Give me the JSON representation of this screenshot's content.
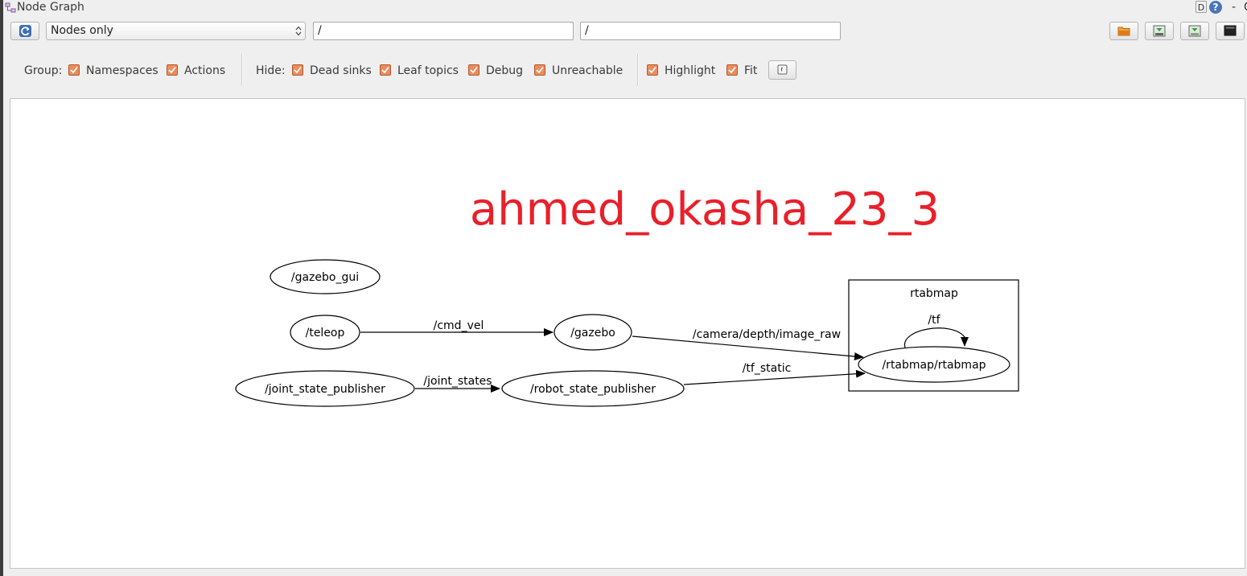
{
  "window": {
    "title": "Node Graph",
    "title_buttons": {
      "d": "D",
      "help": "?",
      "minimize": "-",
      "close": "C"
    }
  },
  "toolbar": {
    "refresh_icon": "refresh-icon",
    "graph_mode": {
      "selected": "Nodes only"
    },
    "node_filter": {
      "value": "/"
    },
    "topic_filter": {
      "value": "/"
    },
    "right_icons": [
      "load-dot-icon",
      "save-dot-icon",
      "save-image-icon",
      "save-svg-icon"
    ]
  },
  "options": {
    "group_label": "Group:",
    "group": [
      {
        "label": "Namespaces",
        "checked": true
      },
      {
        "label": "Actions",
        "checked": true
      }
    ],
    "hide_label": "Hide:",
    "hide": [
      {
        "label": "Dead sinks",
        "checked": true
      },
      {
        "label": "Leaf topics",
        "checked": true
      },
      {
        "label": "Debug",
        "checked": true
      },
      {
        "label": "Unreachable",
        "checked": true
      }
    ],
    "view": [
      {
        "label": "Highlight",
        "checked": true
      },
      {
        "label": "Fit",
        "checked": true
      }
    ],
    "fit_button_icon": "fit-view-icon"
  },
  "canvas": {
    "watermark": "ahmed_okasha_23_3",
    "watermark_color": "#e8202a",
    "cluster": {
      "label": "rtabmap"
    },
    "nodes": {
      "gazebo_gui": "/gazebo_gui",
      "teleop": "/teleop",
      "gazebo": "/gazebo",
      "joint_state_publisher": "/joint_state_publisher",
      "robot_state_publisher": "/robot_state_publisher",
      "rtabmap": "/rtabmap/rtabmap"
    },
    "edges": {
      "cmd_vel": "/cmd_vel",
      "camera_depth": "/camera/depth/image_raw",
      "joint_states": "/joint_states",
      "tf_static": "/tf_static",
      "tf": "/tf"
    }
  }
}
